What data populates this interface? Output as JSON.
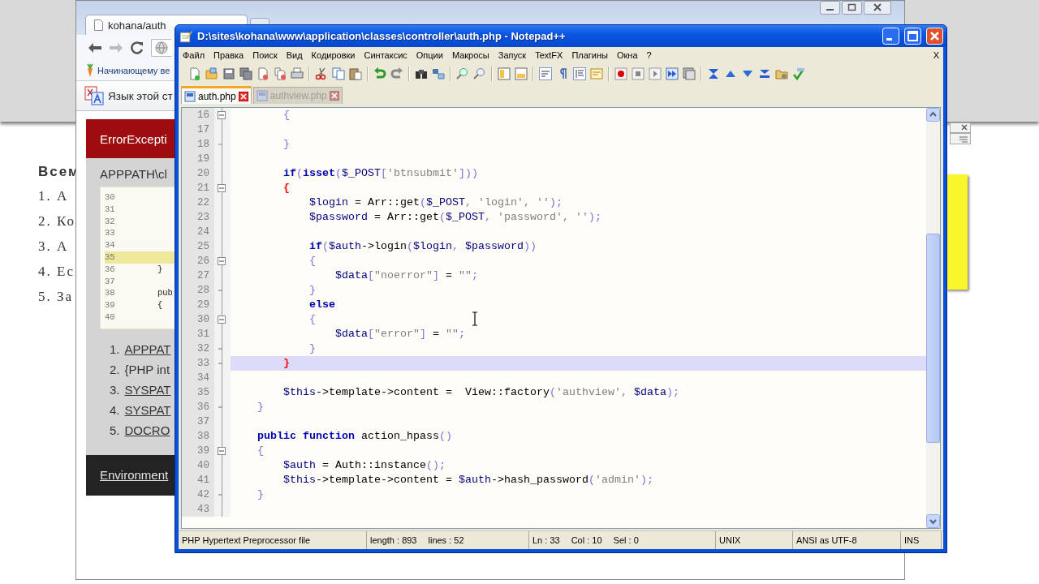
{
  "background_page": {
    "heading": "Всем",
    "list": [
      "1. А",
      "2. Ко",
      "3. А",
      "4. Ес",
      "5. За"
    ]
  },
  "browser": {
    "tab": {
      "title": "kohana/auth"
    },
    "bookmark": "Начинающему ве",
    "translate_bar": "Язык этой ст",
    "error": {
      "title": "ErrorExcepti",
      "path": "APPPATH\\cl",
      "source_lines": [
        {
          "number": "30",
          "highlighted": false
        },
        {
          "number": "31",
          "highlighted": false
        },
        {
          "number": "32",
          "highlighted": false
        },
        {
          "number": "33",
          "highlighted": false
        },
        {
          "number": "34",
          "highlighted": false
        },
        {
          "number": "35",
          "highlighted": true
        },
        {
          "number": "36",
          "text": "}",
          "highlighted": false
        },
        {
          "number": "37",
          "highlighted": false
        },
        {
          "number": "38",
          "text": "pub",
          "highlighted": false
        },
        {
          "number": "39",
          "text": "{",
          "highlighted": false
        },
        {
          "number": "40",
          "highlighted": false
        }
      ],
      "trace": [
        {
          "number": "1.",
          "text": "APPPAT",
          "link": true
        },
        {
          "number": "2.",
          "text": "{PHP int",
          "link": false
        },
        {
          "number": "3.",
          "text": "SYSPAT",
          "link": true
        },
        {
          "number": "4.",
          "text": "SYSPAT",
          "link": true
        },
        {
          "number": "5.",
          "text": "DOCRO",
          "link": true
        }
      ],
      "environment": "Environment"
    }
  },
  "notepad": {
    "title": "D:\\sites\\kohana\\www\\application\\classes\\controller\\auth.php - Notepad++",
    "menu": [
      "Файл",
      "Правка",
      "Поиск",
      "Вид",
      "Кодировки",
      "Синтаксис",
      "Опции",
      "Макросы",
      "Запуск",
      "TextFX",
      "Плагины",
      "Окна",
      "?"
    ],
    "close_document": "X",
    "tabs": [
      {
        "label": "auth.php",
        "selected": true
      },
      {
        "label": "authview.php",
        "selected": false
      }
    ],
    "lines": [
      {
        "number": "16",
        "kind": "fold_start",
        "current": false,
        "tokens": [
          {
            "kind": "punct",
            "text": "        {"
          }
        ]
      },
      {
        "number": "17",
        "kind": "plain",
        "current": false
      },
      {
        "number": "18",
        "kind": "fold_end",
        "current": false,
        "tokens": [
          {
            "kind": "punct",
            "text": "        }"
          }
        ]
      },
      {
        "number": "19",
        "kind": "plain",
        "current": false
      },
      {
        "number": "20",
        "kind": "plain",
        "current": false,
        "tokens": [
          {
            "kind": "keyword",
            "text": "        if"
          },
          {
            "kind": "punct",
            "text": "("
          },
          {
            "kind": "keyword",
            "text": "isset"
          },
          {
            "kind": "punct",
            "text": "("
          },
          {
            "kind": "variable",
            "text": "$_POST"
          },
          {
            "kind": "punct",
            "text": "["
          },
          {
            "kind": "string",
            "text": "'btnsubmit'"
          },
          {
            "kind": "punct",
            "text": "]))"
          }
        ]
      },
      {
        "number": "21",
        "kind": "fold_start",
        "current": false,
        "tokens": [
          {
            "kind": "match",
            "text": "        {"
          }
        ]
      },
      {
        "number": "22",
        "kind": "plain",
        "current": false,
        "tokens": [
          {
            "kind": "variable",
            "text": "            $login"
          },
          {
            "kind": "plain",
            "text": " = Arr::get"
          },
          {
            "kind": "punct",
            "text": "("
          },
          {
            "kind": "variable",
            "text": "$_POST"
          },
          {
            "kind": "punct",
            "text": ", "
          },
          {
            "kind": "string",
            "text": "'login'"
          },
          {
            "kind": "punct",
            "text": ", "
          },
          {
            "kind": "string",
            "text": "''"
          },
          {
            "kind": "punct",
            "text": ");"
          }
        ]
      },
      {
        "number": "23",
        "kind": "plain",
        "current": false,
        "tokens": [
          {
            "kind": "variable",
            "text": "            $password"
          },
          {
            "kind": "plain",
            "text": " = Arr::get"
          },
          {
            "kind": "punct",
            "text": "("
          },
          {
            "kind": "variable",
            "text": "$_POST"
          },
          {
            "kind": "punct",
            "text": ", "
          },
          {
            "kind": "string",
            "text": "'password'"
          },
          {
            "kind": "punct",
            "text": ", "
          },
          {
            "kind": "string",
            "text": "''"
          },
          {
            "kind": "punct",
            "text": ");"
          }
        ]
      },
      {
        "number": "24",
        "kind": "plain",
        "current": false
      },
      {
        "number": "25",
        "kind": "plain",
        "current": false,
        "tokens": [
          {
            "kind": "keyword",
            "text": "            if"
          },
          {
            "kind": "punct",
            "text": "("
          },
          {
            "kind": "variable",
            "text": "$auth"
          },
          {
            "kind": "plain",
            "text": "->login"
          },
          {
            "kind": "punct",
            "text": "("
          },
          {
            "kind": "variable",
            "text": "$login"
          },
          {
            "kind": "punct",
            "text": ", "
          },
          {
            "kind": "variable",
            "text": "$password"
          },
          {
            "kind": "punct",
            "text": "))"
          }
        ]
      },
      {
        "number": "26",
        "kind": "fold_start",
        "current": false,
        "tokens": [
          {
            "kind": "punct",
            "text": "            {"
          }
        ]
      },
      {
        "number": "27",
        "kind": "plain",
        "current": false,
        "tokens": [
          {
            "kind": "variable",
            "text": "                $data"
          },
          {
            "kind": "punct",
            "text": "["
          },
          {
            "kind": "string",
            "text": "\"noerror\""
          },
          {
            "kind": "punct",
            "text": "]"
          },
          {
            "kind": "plain",
            "text": " = "
          },
          {
            "kind": "string",
            "text": "\"\""
          },
          {
            "kind": "punct",
            "text": ";"
          }
        ]
      },
      {
        "number": "28",
        "kind": "fold_end",
        "current": false,
        "tokens": [
          {
            "kind": "punct",
            "text": "            }"
          }
        ]
      },
      {
        "number": "29",
        "kind": "plain",
        "current": false,
        "tokens": [
          {
            "kind": "keyword",
            "text": "            else"
          }
        ]
      },
      {
        "number": "30",
        "kind": "fold_start",
        "current": false,
        "tokens": [
          {
            "kind": "punct",
            "text": "            {"
          }
        ]
      },
      {
        "number": "31",
        "kind": "plain",
        "current": false,
        "tokens": [
          {
            "kind": "variable",
            "text": "                $data"
          },
          {
            "kind": "punct",
            "text": "["
          },
          {
            "kind": "string",
            "text": "\"error\""
          },
          {
            "kind": "punct",
            "text": "]"
          },
          {
            "kind": "plain",
            "text": " = "
          },
          {
            "kind": "string",
            "text": "\"\""
          },
          {
            "kind": "punct",
            "text": ";"
          }
        ]
      },
      {
        "number": "32",
        "kind": "fold_end",
        "current": false,
        "tokens": [
          {
            "kind": "punct",
            "text": "            }"
          }
        ]
      },
      {
        "number": "33",
        "kind": "fold_end",
        "current": true,
        "tokens": [
          {
            "kind": "match",
            "text": "        }"
          }
        ]
      },
      {
        "number": "34",
        "kind": "plain",
        "current": false
      },
      {
        "number": "35",
        "kind": "plain",
        "current": false,
        "tokens": [
          {
            "kind": "variable",
            "text": "        $this"
          },
          {
            "kind": "plain",
            "text": "->template->content =  View::factory"
          },
          {
            "kind": "punct",
            "text": "("
          },
          {
            "kind": "string",
            "text": "'authview'"
          },
          {
            "kind": "punct",
            "text": ", "
          },
          {
            "kind": "variable",
            "text": "$data"
          },
          {
            "kind": "punct",
            "text": ");"
          }
        ]
      },
      {
        "number": "36",
        "kind": "fold_end",
        "current": false,
        "tokens": [
          {
            "kind": "punct",
            "text": "    }"
          }
        ]
      },
      {
        "number": "37",
        "kind": "plain",
        "current": false
      },
      {
        "number": "38",
        "kind": "plain",
        "current": false,
        "tokens": [
          {
            "kind": "keyword",
            "text": "    public function"
          },
          {
            "kind": "plain",
            "text": " action_hpass"
          },
          {
            "kind": "punct",
            "text": "()"
          }
        ]
      },
      {
        "number": "39",
        "kind": "fold_start",
        "current": false,
        "tokens": [
          {
            "kind": "punct",
            "text": "    {"
          }
        ]
      },
      {
        "number": "40",
        "kind": "plain",
        "current": false,
        "tokens": [
          {
            "kind": "variable",
            "text": "        $auth"
          },
          {
            "kind": "plain",
            "text": " = Auth::instance"
          },
          {
            "kind": "punct",
            "text": "();"
          }
        ]
      },
      {
        "number": "41",
        "kind": "plain",
        "current": false,
        "tokens": [
          {
            "kind": "variable",
            "text": "        $this"
          },
          {
            "kind": "plain",
            "text": "->template->content = "
          },
          {
            "kind": "variable",
            "text": "$auth"
          },
          {
            "kind": "plain",
            "text": "->hash_password"
          },
          {
            "kind": "punct",
            "text": "("
          },
          {
            "kind": "string",
            "text": "'admin'"
          },
          {
            "kind": "punct",
            "text": ");"
          }
        ]
      },
      {
        "number": "42",
        "kind": "fold_end",
        "current": false,
        "tokens": [
          {
            "kind": "punct",
            "text": "    }"
          }
        ]
      },
      {
        "number": "43",
        "kind": "plain",
        "current": false
      }
    ],
    "status_bar": {
      "file_type": "PHP Hypertext Preprocessor file",
      "length": "length : 893",
      "lines": "lines : 52",
      "line": "Ln : 33",
      "column": "Col : 10",
      "selection": "Sel : 0",
      "eol": "UNIX",
      "encoding": "ANSI as UTF-8",
      "mode": "INS"
    }
  }
}
